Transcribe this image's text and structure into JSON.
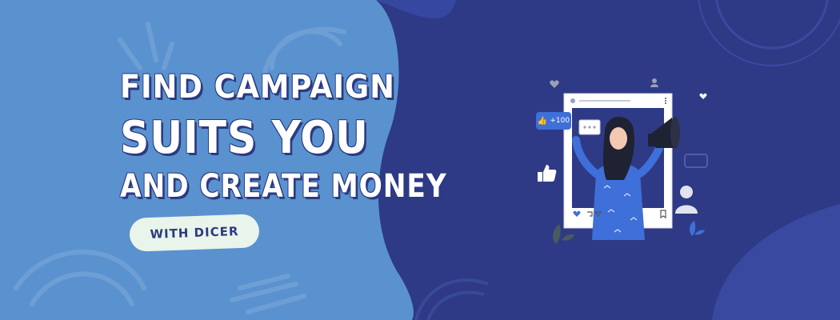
{
  "banner": {
    "headline_line1": "FIND CAMPAIGN",
    "headline_line2": "SUITS YOU",
    "headline_line3": "AND CREATE MONEY",
    "tagline": "WITH DICER"
  },
  "illustration": {
    "like_count": "+100",
    "icons": [
      "thumbs-up-icon",
      "heart-icon",
      "user-icon",
      "megaphone-icon",
      "chat-bubble-icon",
      "bookmark-icon",
      "comment-icon",
      "share-icon"
    ]
  },
  "colors": {
    "light_blue": "#5a92cf",
    "navy": "#2e3a86",
    "accent_blue": "#3f6fd8",
    "pill_bg": "#e9f4ea",
    "text_navy": "#2b3a82"
  }
}
